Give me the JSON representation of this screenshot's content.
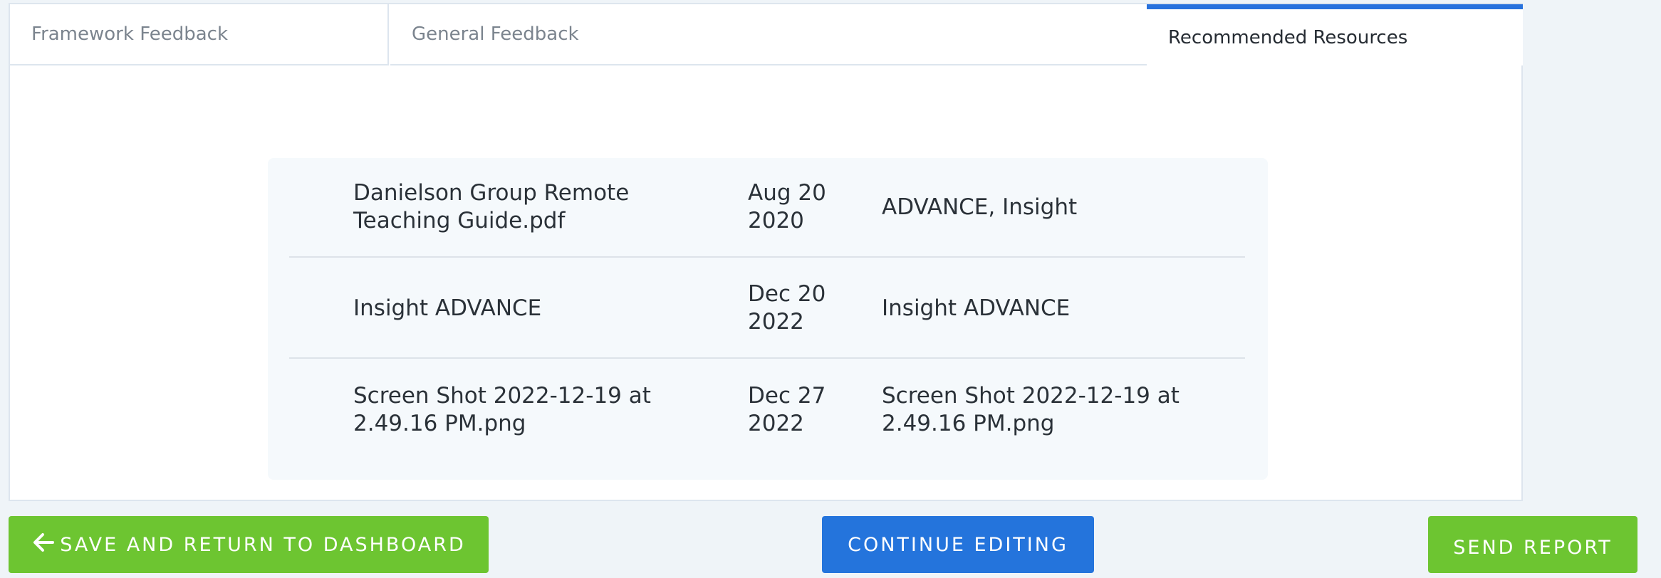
{
  "tabs": [
    {
      "label": "Framework Feedback",
      "active": false
    },
    {
      "label": "General Feedback",
      "active": false
    },
    {
      "label": "Recommended Resources",
      "active": true
    }
  ],
  "resources": [
    {
      "name": "Danielson Group Remote Teaching Guide.pdf",
      "date": "Aug 20 2020",
      "tags": "ADVANCE, Insight"
    },
    {
      "name": "Insight ADVANCE",
      "date": "Dec 20 2022",
      "tags": "Insight ADVANCE"
    },
    {
      "name": "Screen Shot 2022-12-19 at 2.49.16 PM.png",
      "date": "Dec 27 2022",
      "tags": "Screen Shot 2022-12-19 at 2.49.16 PM.png"
    }
  ],
  "footer": {
    "save_label": "SAVE AND RETURN TO DASHBOARD",
    "continue_label": "CONTINUE EDITING",
    "send_label": "SEND REPORT"
  },
  "colors": {
    "accent_blue": "#2474dc",
    "accent_green": "#6dc531",
    "active_tab_border": "#2872dd"
  },
  "icons": {
    "save_button_icon": "arrow-left-icon"
  }
}
